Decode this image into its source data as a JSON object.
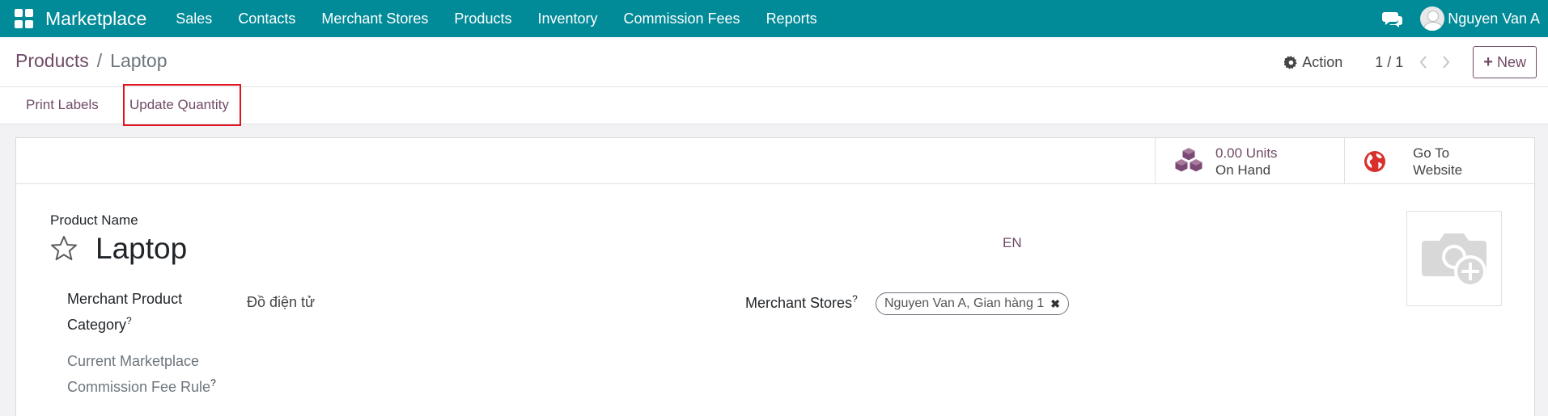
{
  "navbar": {
    "brand": "Marketplace",
    "menu": [
      "Sales",
      "Contacts",
      "Merchant Stores",
      "Products",
      "Inventory",
      "Commission Fees",
      "Reports"
    ],
    "user": "Nguyen Van A",
    "bg_color": "#018a97"
  },
  "breadcrumb": {
    "parent": "Products",
    "separator": "/",
    "current": "Laptop"
  },
  "control": {
    "action_label": "Action",
    "pager": "1 / 1",
    "new_label": "New"
  },
  "statusbar": {
    "print_labels": "Print Labels",
    "update_quantity": "Update Quantity"
  },
  "smart_buttons": {
    "on_hand_value": "0.00 Units",
    "on_hand_label": "On Hand",
    "website_line1": "Go To",
    "website_line2": "Website"
  },
  "form": {
    "product_name_label": "Product Name",
    "product_name": "Laptop",
    "lang": "EN",
    "merchant_category_label_1": "Merchant Product",
    "merchant_category_label_2": "Category",
    "merchant_category_value": "Đồ điện tử",
    "commission_label_1": "Current Marketplace",
    "commission_label_2": "Commission Fee Rule",
    "merchant_stores_label": "Merchant Stores",
    "merchant_stores_tag": "Nguyen Van A, Gian hàng 1",
    "help_mark": "?"
  },
  "colors": {
    "accent": "#714b67",
    "highlight": "#e0141e"
  }
}
